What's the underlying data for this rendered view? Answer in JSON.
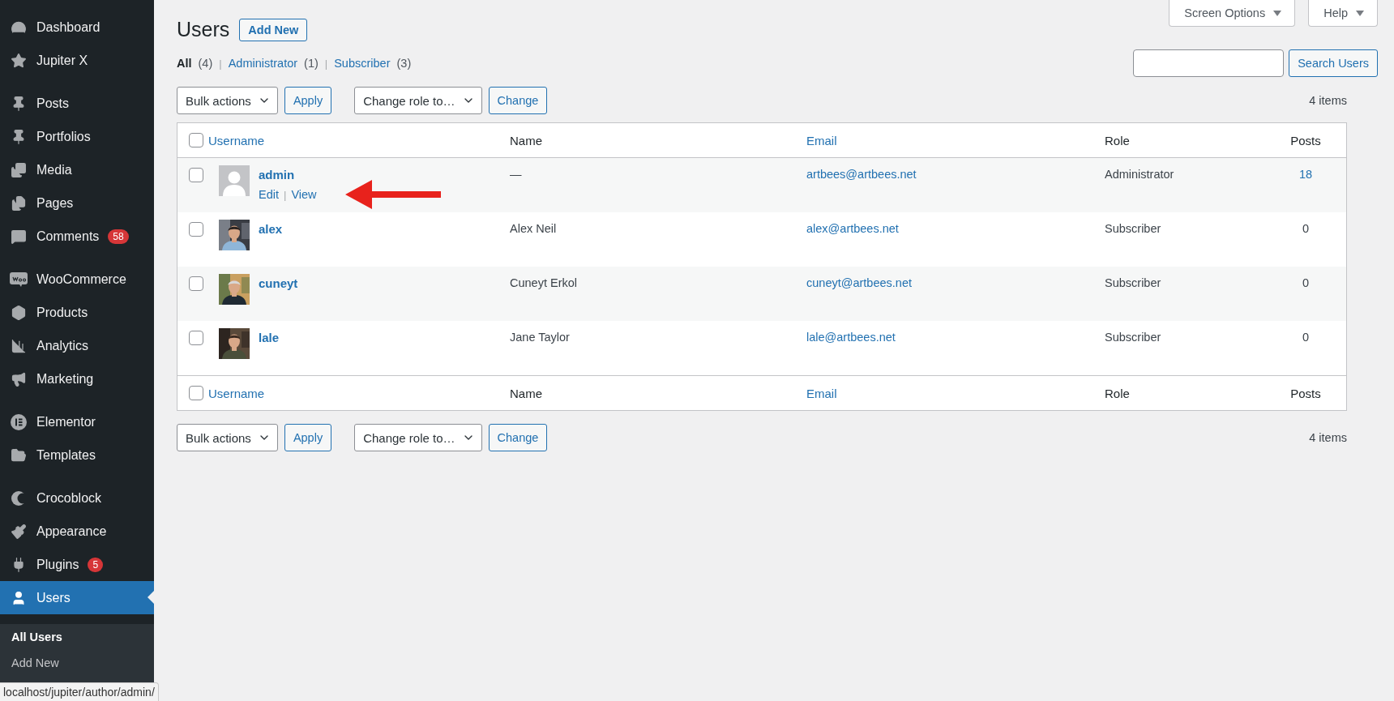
{
  "sidebar": {
    "groups": [
      {
        "items": [
          {
            "label": "Dashboard",
            "selected": false
          },
          {
            "label": "Jupiter X",
            "selected": false
          }
        ]
      },
      {
        "items": [
          {
            "label": "Posts",
            "selected": false
          },
          {
            "label": "Portfolios",
            "selected": false
          },
          {
            "label": "Media",
            "selected": false
          },
          {
            "label": "Pages",
            "selected": false
          },
          {
            "label": "Comments",
            "badge": "58",
            "selected": false
          }
        ]
      },
      {
        "items": [
          {
            "label": "WooCommerce",
            "selected": false
          },
          {
            "label": "Products",
            "selected": false
          },
          {
            "label": "Analytics",
            "selected": false
          },
          {
            "label": "Marketing",
            "selected": false
          }
        ]
      },
      {
        "items": [
          {
            "label": "Elementor",
            "selected": false
          },
          {
            "label": "Templates",
            "selected": false
          }
        ]
      },
      {
        "items": [
          {
            "label": "Crocoblock",
            "selected": false
          },
          {
            "label": "Appearance",
            "selected": false
          },
          {
            "label": "Plugins",
            "badge": "5",
            "selected": false
          },
          {
            "label": "Users",
            "selected": true
          }
        ]
      }
    ],
    "submenu": [
      {
        "label": "All Users",
        "selected": true
      },
      {
        "label": "Add New",
        "selected": false
      }
    ]
  },
  "screen_tabs": [
    {
      "label": "Screen Options"
    },
    {
      "label": "Help"
    }
  ],
  "title": "Users",
  "add_new": "Add New",
  "filters": [
    {
      "label": "All",
      "count": "(4)",
      "selected": true
    },
    {
      "separator": "|",
      "label": "Administrator",
      "count": "(1)",
      "selected": false
    },
    {
      "separator": "|",
      "label": "Subscriber",
      "count": "(3)",
      "selected": false
    }
  ],
  "search": {
    "button": "Search Users"
  },
  "toolbars": [
    {
      "bulk": "Bulk actions",
      "apply": "Apply",
      "role": "Change role to…",
      "change": "Change",
      "count": "4 items"
    },
    {
      "bulk": "Bulk actions",
      "apply": "Apply",
      "role": "Change role to…",
      "change": "Change",
      "count": "4 items"
    }
  ],
  "table": {
    "columns": [
      {
        "label": "Username",
        "sortable": true
      },
      {
        "label": "Name",
        "sortable": false
      },
      {
        "label": "Email",
        "sortable": true
      },
      {
        "label": "Role",
        "sortable": false
      },
      {
        "label": "Posts",
        "sortable": false
      }
    ],
    "footer_columns": [
      {
        "label": "Username",
        "sortable": true
      },
      {
        "label": "Name",
        "sortable": false
      },
      {
        "label": "Email",
        "sortable": true
      },
      {
        "label": "Role",
        "sortable": false
      },
      {
        "label": "Posts",
        "sortable": false
      }
    ],
    "header_checked": false,
    "footer_checked": false,
    "rows": [
      {
        "username": "admin",
        "avatar": {
          "kind": "default"
        },
        "name": "—",
        "email": "artbees@artbees.net",
        "role": "Administrator",
        "posts": "18",
        "posts_linked": true,
        "checked": false,
        "actions": [
          {
            "label": "Edit"
          },
          {
            "separator": "|",
            "label": "View"
          }
        ]
      },
      {
        "username": "alex",
        "name": "Alex Neil",
        "email": "alex@artbees.net",
        "role": "Subscriber",
        "posts": "0",
        "posts_linked": false,
        "checked": false
      },
      {
        "username": "cuneyt",
        "name": "Cuneyt Erkol",
        "email": "cuneyt@artbees.net",
        "role": "Subscriber",
        "posts": "0",
        "posts_linked": false,
        "checked": false
      },
      {
        "username": "lale",
        "name": "Jane Taylor",
        "email": "lale@artbees.net",
        "role": "Subscriber",
        "posts": "0",
        "posts_linked": false,
        "checked": false
      }
    ]
  },
  "status_bar": "localhost/jupiter/author/admin/"
}
